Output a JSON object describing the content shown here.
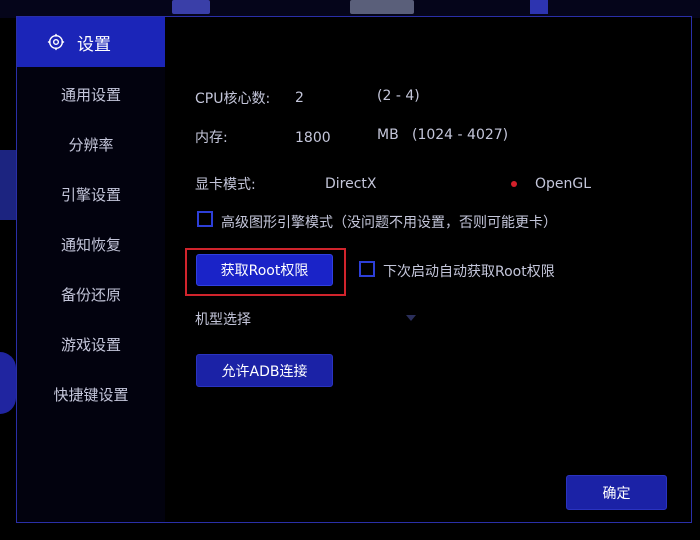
{
  "sidebar": {
    "title": "设置",
    "items": [
      "通用设置",
      "分辨率",
      "引擎设置",
      "通知恢复",
      "备份还原",
      "游戏设置",
      "快捷键设置"
    ]
  },
  "cpu": {
    "label": "CPU核心数:",
    "value": "2",
    "range": "(2 - 4)"
  },
  "memory": {
    "label": "内存:",
    "value": "1800",
    "unit": "MB",
    "range": "(1024 - 4027)"
  },
  "graphics": {
    "label": "显卡模式:",
    "option_directx": "DirectX",
    "option_opengl": "OpenGL",
    "selected": "OpenGL"
  },
  "advanced_engine": {
    "label": "高级图形引擎模式（没问题不用设置，否则可能更卡）",
    "checked": false
  },
  "root": {
    "button_label": "获取Root权限",
    "auto_label": "下次启动自动获取Root权限",
    "auto_checked": false
  },
  "device": {
    "label": "机型选择"
  },
  "adb": {
    "button_label": "允许ADB连接"
  },
  "footer": {
    "confirm_label": "确定"
  },
  "colors": {
    "accent": "#1b25b8",
    "highlight": "#d1242c",
    "radio": "#d4202a"
  }
}
